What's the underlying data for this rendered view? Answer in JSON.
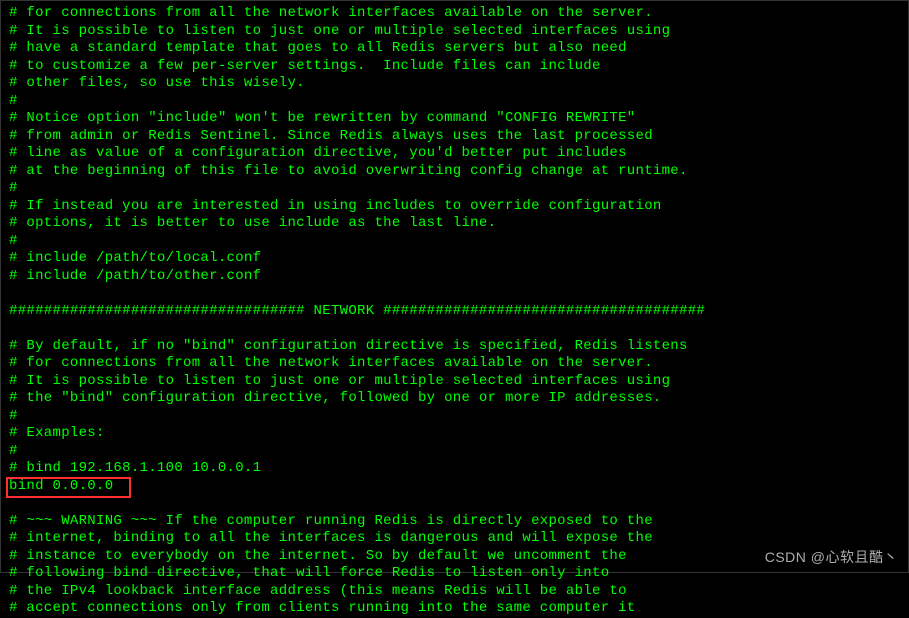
{
  "lines": [
    "# for connections from all the network interfaces available on the server.",
    "# It is possible to listen to just one or multiple selected interfaces using",
    "# have a standard template that goes to all Redis servers but also need",
    "# to customize a few per-server settings.  Include files can include",
    "# other files, so use this wisely.",
    "#",
    "# Notice option \"include\" won't be rewritten by command \"CONFIG REWRITE\"",
    "# from admin or Redis Sentinel. Since Redis always uses the last processed",
    "# line as value of a configuration directive, you'd better put includes",
    "# at the beginning of this file to avoid overwriting config change at runtime.",
    "#",
    "# If instead you are interested in using includes to override configuration",
    "# options, it is better to use include as the last line.",
    "#",
    "# include /path/to/local.conf",
    "# include /path/to/other.conf",
    "",
    "################################## NETWORK #####################################",
    "",
    "# By default, if no \"bind\" configuration directive is specified, Redis listens",
    "# for connections from all the network interfaces available on the server.",
    "# It is possible to listen to just one or multiple selected interfaces using",
    "# the \"bind\" configuration directive, followed by one or more IP addresses.",
    "#",
    "# Examples:",
    "#",
    "# bind 192.168.1.100 10.0.0.1",
    "bind 0.0.0.0",
    "",
    "# ~~~ WARNING ~~~ If the computer running Redis is directly exposed to the",
    "# internet, binding to all the interfaces is dangerous and will expose the",
    "# instance to everybody on the internet. So by default we uncomment the",
    "# following bind directive, that will force Redis to listen only into",
    "# the IPv4 lookback interface address (this means Redis will be able to",
    "# accept connections only from clients running into the same computer it"
  ],
  "highlight": {
    "target_line_index": 27,
    "text": "bind 0.0.0.0"
  },
  "watermark": "CSDN @心软且酷丶"
}
